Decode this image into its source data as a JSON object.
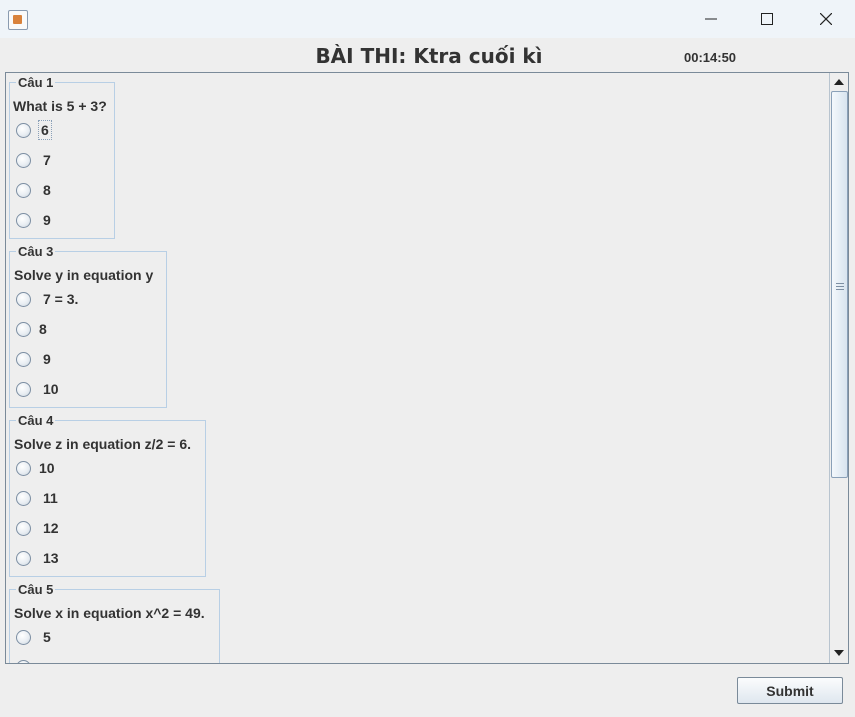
{
  "window": {
    "icon": "java-cup-icon",
    "controls": [
      "minimize-icon",
      "maximize-icon",
      "close-icon"
    ]
  },
  "header": {
    "title": "BÀI THI: Ktra cuối kì",
    "timer": "00:14:50"
  },
  "questions": [
    {
      "label": "Câu 1",
      "text": "What is 5 + 3?",
      "options": [
        "6",
        "7",
        "8",
        "9"
      ]
    },
    {
      "label": "Câu 3",
      "text": "Solve y in equation y",
      "options": [
        "7 = 3.",
        "8",
        "9",
        "10"
      ]
    },
    {
      "label": "Câu 4",
      "text": "Solve z in equation z/2 = 6.",
      "options": [
        "10",
        "11",
        "12",
        "13"
      ]
    },
    {
      "label": "Câu 5",
      "text": "Solve x in equation x^2 = 49.",
      "options": [
        "5"
      ]
    }
  ],
  "footer": {
    "submit_label": "Submit"
  }
}
